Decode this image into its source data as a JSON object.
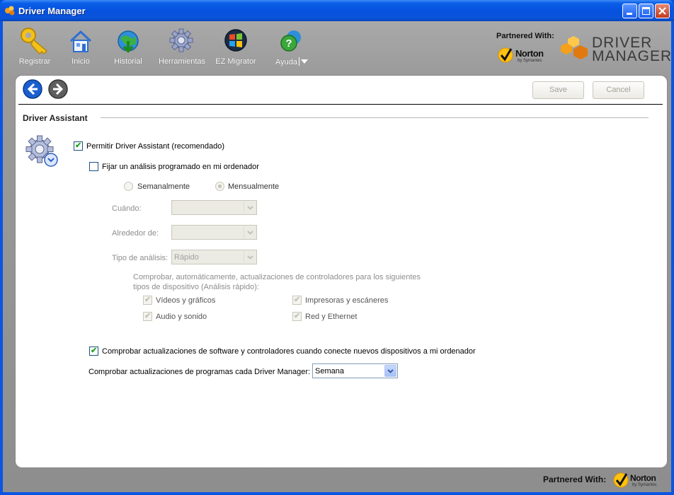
{
  "window": {
    "title": "Driver Manager"
  },
  "toolbar": {
    "items": [
      {
        "label": "Registrar",
        "icon": "key-icon"
      },
      {
        "label": "Inicio",
        "icon": "home-icon"
      },
      {
        "label": "Historial",
        "icon": "history-globe-icon"
      },
      {
        "label": "Herramientas",
        "icon": "gear-icon"
      },
      {
        "label": "EZ Migrator",
        "icon": "windows-migrator-icon"
      },
      {
        "label": "Ayuda",
        "icon": "help-icon"
      }
    ]
  },
  "branding": {
    "partnered_with": "Partnered With:",
    "norton": "Norton",
    "norton_sub": "by Symantec",
    "logo_line1": "DRIVER",
    "logo_line2": "MANAGER"
  },
  "actions": {
    "save": "Save",
    "cancel": "Cancel"
  },
  "section": {
    "title": "Driver Assistant"
  },
  "settings": {
    "enable_assistant": {
      "label": "Permitir Driver Assistant (recomendado)",
      "checked": true
    },
    "schedule": {
      "label": "Fijar un análisis programado en mi ordenador",
      "checked": false
    },
    "frequency": {
      "weekly": "Semanalmente",
      "monthly": "Mensualmente",
      "selected": "monthly"
    },
    "when_label": "Cuándo:",
    "when_value": "",
    "around_label": "Alrededor de:",
    "around_value": "",
    "scan_type_label": "Tipo de análisis:",
    "scan_type_value": "Rápido",
    "auto_check_line1": "Comprobar, automáticamente, actualizaciones de controladores para los siguientes",
    "auto_check_line2": "tipos de dispositivo (Análisis rápido):",
    "device_types": [
      {
        "label": "Vídeos y gráficos",
        "checked": true
      },
      {
        "label": "Impresoras y escáneres",
        "checked": true
      },
      {
        "label": "Audio y sonido",
        "checked": true
      },
      {
        "label": "Red y Ethernet",
        "checked": true
      }
    ],
    "check_on_new_device": {
      "label": "Comprobar actualizaciones de software y controladores cuando conecte nuevos dispositivos a mi ordenador",
      "checked": true
    },
    "program_update_label": "Comprobar actualizaciones de programas cada Driver Manager:",
    "program_update_value": "Semana"
  },
  "colors": {
    "accent": "#0b55e3",
    "check": "#21a121",
    "logo_orange": "#f5a01a"
  }
}
